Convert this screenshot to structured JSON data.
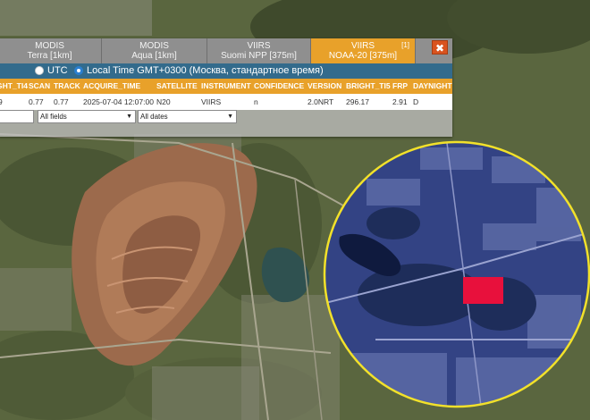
{
  "tabs": [
    {
      "line1": "MODIS",
      "line2": "Terra [1km]",
      "active": false
    },
    {
      "line1": "MODIS",
      "line2": "Aqua [1km]",
      "active": false
    },
    {
      "line1": "VIIRS",
      "line2": "Suomi NPP [375m]",
      "active": false
    },
    {
      "line1": "VIIRS",
      "line2": "NOAA-20 [375m]",
      "active": true,
      "badge": "[1]"
    }
  ],
  "close_label": "✖",
  "timezone": {
    "utc_label": "UTC",
    "local_label": "Local Time GMT+0300 (Москва, стандартное время)",
    "selected": "local"
  },
  "table": {
    "headers": [
      "GHT_TI4",
      "SCAN",
      "TRACK",
      "ACQUIRE_TIME",
      "SATELLITE",
      "INSTRUMENT",
      "CONFIDENCE",
      "VERSION",
      "BRIGHT_TI5",
      "FRP",
      "DAYNIGHT"
    ],
    "row": [
      "9",
      "0.77",
      "0.77",
      "2025-07-04 12:07:00",
      "N20",
      "VIIRS",
      "n",
      "2.0NRT",
      "296.17",
      "2.91",
      "D"
    ]
  },
  "filters": {
    "first_value": "",
    "fields_value": "All fields",
    "dates_value": "All dates"
  },
  "colors": {
    "active_tab": "#e8a12a",
    "tz_bar": "#336b8c",
    "highlight_circle": "#f2e12a",
    "fire_marker": "#e8103c"
  }
}
